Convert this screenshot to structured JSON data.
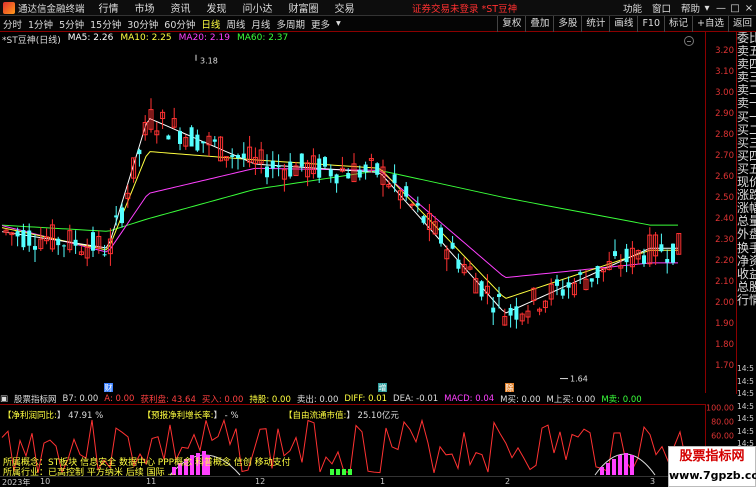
{
  "titlebar": {
    "app_title": "通达信金融终端",
    "menu": [
      "行情",
      "市场",
      "资讯",
      "发现",
      "问小达",
      "财富圈",
      "交易"
    ],
    "notice": "证券交易未登录 *ST豆神",
    "right_items": [
      "功能",
      "窗口",
      "帮助"
    ],
    "controls": [
      "▾",
      "—",
      "□",
      "×"
    ]
  },
  "toolbar": {
    "periods": [
      "分时",
      "1分钟",
      "5分钟",
      "15分钟",
      "30分钟",
      "60分钟",
      "日线",
      "周线",
      "月线",
      "多周期",
      "更多"
    ],
    "active_period": "日线",
    "more_icon": "chevron-down-icon",
    "buttons": [
      "复权",
      "叠加",
      "多股",
      "统计",
      "画线",
      "F10",
      "标记",
      "+自选",
      "返回"
    ]
  },
  "chart": {
    "header": {
      "symbol": "*ST豆神(日线)",
      "ma5": "MA5: 2.26",
      "ma10": "MA10: 2.25",
      "ma20": "MA20: 2.19",
      "ma60": "MA60: 2.37"
    },
    "price_ticks": [
      "3.20",
      "3.10",
      "3.00",
      "2.90",
      "2.80",
      "2.70",
      "2.60",
      "2.50",
      "2.40",
      "2.30",
      "2.20",
      "2.10",
      "2.00",
      "1.90",
      "1.80",
      "1.70"
    ],
    "high_label": "3.18",
    "low_label": "1.64",
    "event_markers": [
      {
        "label": "财",
        "color": "#3a7fff"
      },
      {
        "label": "增",
        "color": "#2fa0a0"
      },
      {
        "label": "除",
        "color": "#e0802a"
      }
    ],
    "colors": {
      "up": "#ff3232",
      "down": "#54ffff",
      "ma5": "#ffffff",
      "ma10": "#ffff40",
      "ma20": "#ff40ff",
      "ma60": "#3aff3a"
    }
  },
  "chart_data": {
    "type": "line",
    "title": "*ST豆神(日线)",
    "xlabel": "",
    "ylabel": "",
    "ylim": [
      1.6,
      3.25
    ],
    "grid": false,
    "x": [
      "2023-09",
      "2023-10",
      "2023-11",
      "2023-12",
      "2024-01",
      "2024-02",
      "2024-03"
    ],
    "series": [
      {
        "name": "MA5",
        "values": [
          2.34,
          2.26,
          2.88,
          2.66,
          2.62,
          1.95,
          2.26
        ]
      },
      {
        "name": "MA10",
        "values": [
          2.36,
          2.25,
          2.72,
          2.68,
          2.64,
          2.02,
          2.25
        ]
      },
      {
        "name": "MA20",
        "values": [
          2.37,
          2.24,
          2.52,
          2.64,
          2.63,
          2.12,
          2.19
        ]
      },
      {
        "name": "MA60",
        "values": [
          2.37,
          2.34,
          2.4,
          2.54,
          2.63,
          2.5,
          2.37
        ]
      }
    ],
    "annotations": [
      "3.18",
      "1.64"
    ]
  },
  "indicator": {
    "name": "股票指标网",
    "b7": "B7: 0.00",
    "a": "A: 0.00",
    "profit": "获利盘: 43.64",
    "buy_in": "买入: 0.00",
    "hold": "持股: 0.00",
    "sell": "卖出: 0.00",
    "diff": "DIFF: 0.01",
    "dea": "DEA: -0.01",
    "macd": "MACD: 0.04",
    "m_buy": "M买: 0.00",
    "m_up_buy": "M上买: 0.00",
    "m_sell": "M卖: 0.00",
    "net_profit_label": "【净利润同比:",
    "net_profit_value": "】 47.91 %",
    "forecast_label": "【预报净利增长率:",
    "forecast_value": "】 - %",
    "float_mv_label": "【自由流通市值:",
    "float_mv_value": "】 25.10亿元",
    "axis_ticks": [
      "100.00",
      "80.00",
      "60.00",
      "40.00",
      "20.00"
    ],
    "concepts_label": "所属概念：",
    "concepts": "ST板块 信息安全 数据中心 PPP概念 科普概念 信创 移动支付",
    "industry_label": "所属行业：",
    "industry": "已高控制 平方纳米 后续 国际 ..."
  },
  "dates": [
    "2023年",
    "10",
    "11",
    "12",
    "1",
    "2",
    "3"
  ],
  "side_panel": {
    "labels": [
      "委比",
      "卖五",
      "卖四",
      "卖三",
      "卖二",
      "卖一",
      "买一",
      "买二",
      "买三",
      "买四",
      "买五",
      "现价",
      "涨跌",
      "涨幅",
      "总量",
      "外盘",
      "换手",
      "净资",
      "收益",
      "总股",
      "行情"
    ],
    "times": [
      "14:5",
      "14:5",
      "14:5",
      "14:5",
      "14:5",
      "14:5",
      "14:5"
    ]
  },
  "watermark": {
    "title": "股票指标网",
    "url": "www.7gpzb.com"
  }
}
